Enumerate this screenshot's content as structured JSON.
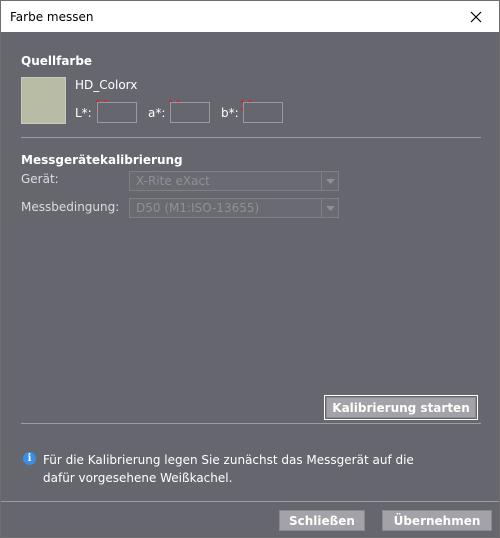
{
  "window": {
    "title": "Farbe messen"
  },
  "source_color": {
    "section_title": "Quellfarbe",
    "name": "HD_Colorx",
    "swatch_color": "#b8bca4",
    "l_label": "L*:",
    "a_label": "a*:",
    "b_label": "b*:",
    "l_value": "",
    "a_value": "",
    "b_value": ""
  },
  "calibration": {
    "section_title": "Messgerätekalibrierung",
    "device_label": "Gerät:",
    "device_value": "X-Rite eXact",
    "condition_label": "Messbedingung:",
    "condition_value": "D50 (M1:ISO-13655)",
    "start_button": "Kalibrierung starten"
  },
  "info": {
    "text": "Für die Kalibrierung legen Sie zunächst das Messgerät auf die dafür vorgesehene Weißkachel."
  },
  "footer": {
    "close_button": "Schließen",
    "apply_button": "Übernehmen"
  },
  "icons": {
    "close": "close-icon",
    "error": "error-x-icon",
    "info": "info-icon",
    "dropdown": "chevron-down-icon"
  }
}
